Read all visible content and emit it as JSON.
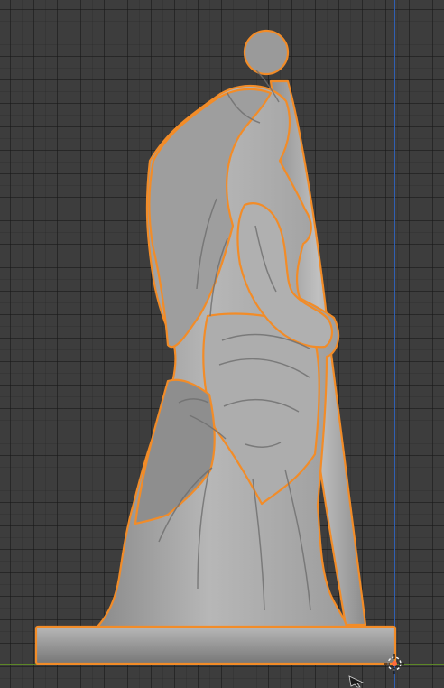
{
  "viewport": {
    "view": "side",
    "background_color": "#3d3d3d",
    "grid_color": "#2a2a2a",
    "axis_colors": {
      "z": "#2f61b8",
      "y": "#5f8b26"
    }
  },
  "selection": {
    "outline_color": "#f28c28",
    "object": "figure-with-staff-on-round-base"
  },
  "icons": {
    "origin": "3d-cursor-icon",
    "cursor": "mouse-arrow-icon"
  }
}
